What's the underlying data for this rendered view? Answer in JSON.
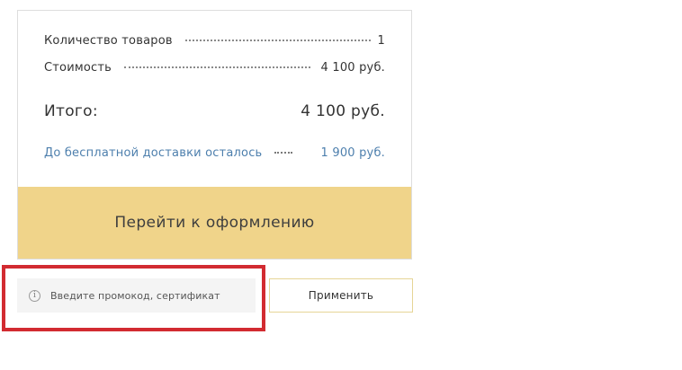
{
  "summary": {
    "items_count_label": "Количество товаров",
    "items_count_value": "1",
    "cost_label": "Стоимость",
    "cost_value": "4 100 руб.",
    "total_label": "Итого:",
    "total_value": "4 100 руб.",
    "free_delivery_label": "До бесплатной доставки осталось",
    "free_delivery_value": "1 900 руб."
  },
  "checkout_button_label": "Перейти к оформлению",
  "promo": {
    "info_icon": "info-icon",
    "icon_glyph": "i",
    "placeholder": "Введите промокод, сертификат",
    "apply_label": "Применить"
  },
  "colors": {
    "checkout_button_bg": "#f0d48a",
    "delivery_text": "#4d7fad",
    "highlight_border": "#d22b31",
    "apply_border": "#e6d596"
  }
}
